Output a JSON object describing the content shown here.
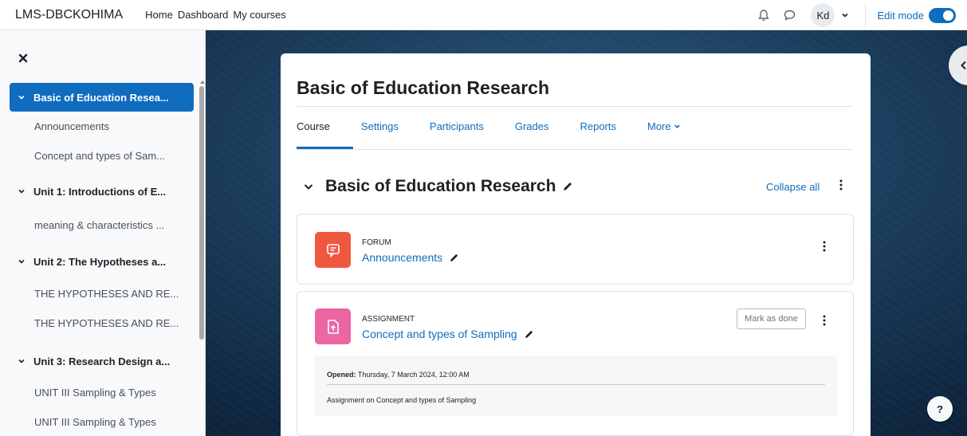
{
  "navbar": {
    "brand": "LMS-DBCKOHIMA",
    "links": [
      "Home",
      "Dashboard",
      "My courses"
    ],
    "avatar_initials": "Kd",
    "edit_mode_label": "Edit mode",
    "edit_mode_on": true
  },
  "drawer": {
    "items": [
      {
        "label": "Basic of Education Resea...",
        "kind": "section",
        "active": true
      },
      {
        "label": "Announcements",
        "kind": "sub"
      },
      {
        "label": "Concept and types of Sam...",
        "kind": "sub"
      },
      {
        "label": "Unit 1: Introductions of E...",
        "kind": "section"
      },
      {
        "label": "meaning & characteristics ...",
        "kind": "sub"
      },
      {
        "label": "Unit 2: The Hypotheses a...",
        "kind": "section"
      },
      {
        "label": "THE HYPOTHESES AND RE...",
        "kind": "sub"
      },
      {
        "label": "THE HYPOTHESES AND RE...",
        "kind": "sub"
      },
      {
        "label": "Unit 3: Research Design a...",
        "kind": "section"
      },
      {
        "label": "UNIT III Sampling & Types",
        "kind": "sub"
      },
      {
        "label": "UNIT III Sampling & Types",
        "kind": "sub"
      }
    ]
  },
  "course": {
    "title": "Basic of Education Research",
    "tabs": [
      "Course",
      "Settings",
      "Participants",
      "Grades",
      "Reports",
      "More"
    ],
    "active_tab": "Course"
  },
  "section": {
    "title": "Basic of Education Research",
    "collapse_label": "Collapse all"
  },
  "activities": [
    {
      "type": "FORUM",
      "name": "Announcements",
      "icon": "forum-icon",
      "color": "#f0573f"
    },
    {
      "type": "ASSIGNMENT",
      "name": "Concept and types of Sampling",
      "icon": "assignment-icon",
      "color": "#eb66a2",
      "mark_done_label": "Mark as done",
      "opened_label": "Opened:",
      "opened_value": "Thursday, 7 March 2024, 12:00 AM",
      "description": "Assignment on Concept and types of Sampling"
    }
  ],
  "help_label": "?",
  "colors": {
    "primary": "#0f6cbf",
    "forum": "#f0573f",
    "assignment": "#eb66a2"
  }
}
